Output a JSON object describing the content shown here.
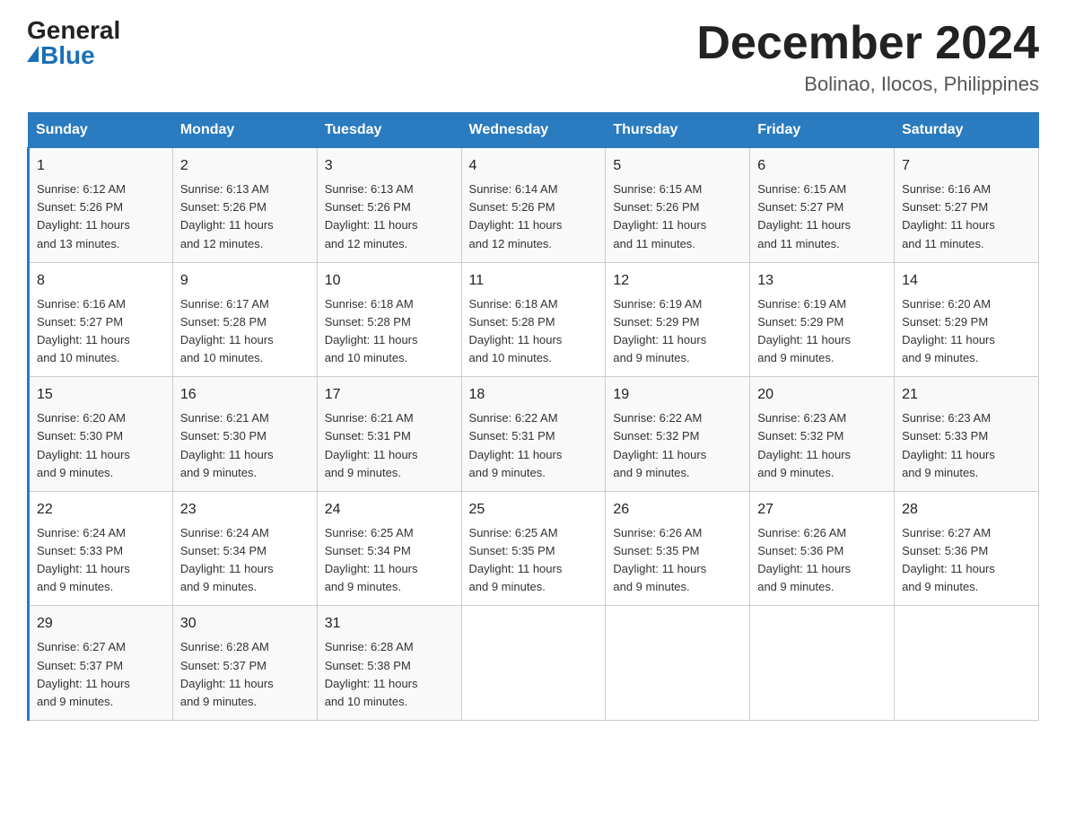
{
  "logo": {
    "general": "General",
    "blue": "Blue"
  },
  "title": {
    "month_year": "December 2024",
    "location": "Bolinao, Ilocos, Philippines"
  },
  "headers": [
    "Sunday",
    "Monday",
    "Tuesday",
    "Wednesday",
    "Thursday",
    "Friday",
    "Saturday"
  ],
  "weeks": [
    [
      {
        "day": "1",
        "sunrise": "6:12 AM",
        "sunset": "5:26 PM",
        "daylight": "11 hours and 13 minutes."
      },
      {
        "day": "2",
        "sunrise": "6:13 AM",
        "sunset": "5:26 PM",
        "daylight": "11 hours and 12 minutes."
      },
      {
        "day": "3",
        "sunrise": "6:13 AM",
        "sunset": "5:26 PM",
        "daylight": "11 hours and 12 minutes."
      },
      {
        "day": "4",
        "sunrise": "6:14 AM",
        "sunset": "5:26 PM",
        "daylight": "11 hours and 12 minutes."
      },
      {
        "day": "5",
        "sunrise": "6:15 AM",
        "sunset": "5:26 PM",
        "daylight": "11 hours and 11 minutes."
      },
      {
        "day": "6",
        "sunrise": "6:15 AM",
        "sunset": "5:27 PM",
        "daylight": "11 hours and 11 minutes."
      },
      {
        "day": "7",
        "sunrise": "6:16 AM",
        "sunset": "5:27 PM",
        "daylight": "11 hours and 11 minutes."
      }
    ],
    [
      {
        "day": "8",
        "sunrise": "6:16 AM",
        "sunset": "5:27 PM",
        "daylight": "11 hours and 10 minutes."
      },
      {
        "day": "9",
        "sunrise": "6:17 AM",
        "sunset": "5:28 PM",
        "daylight": "11 hours and 10 minutes."
      },
      {
        "day": "10",
        "sunrise": "6:18 AM",
        "sunset": "5:28 PM",
        "daylight": "11 hours and 10 minutes."
      },
      {
        "day": "11",
        "sunrise": "6:18 AM",
        "sunset": "5:28 PM",
        "daylight": "11 hours and 10 minutes."
      },
      {
        "day": "12",
        "sunrise": "6:19 AM",
        "sunset": "5:29 PM",
        "daylight": "11 hours and 9 minutes."
      },
      {
        "day": "13",
        "sunrise": "6:19 AM",
        "sunset": "5:29 PM",
        "daylight": "11 hours and 9 minutes."
      },
      {
        "day": "14",
        "sunrise": "6:20 AM",
        "sunset": "5:29 PM",
        "daylight": "11 hours and 9 minutes."
      }
    ],
    [
      {
        "day": "15",
        "sunrise": "6:20 AM",
        "sunset": "5:30 PM",
        "daylight": "11 hours and 9 minutes."
      },
      {
        "day": "16",
        "sunrise": "6:21 AM",
        "sunset": "5:30 PM",
        "daylight": "11 hours and 9 minutes."
      },
      {
        "day": "17",
        "sunrise": "6:21 AM",
        "sunset": "5:31 PM",
        "daylight": "11 hours and 9 minutes."
      },
      {
        "day": "18",
        "sunrise": "6:22 AM",
        "sunset": "5:31 PM",
        "daylight": "11 hours and 9 minutes."
      },
      {
        "day": "19",
        "sunrise": "6:22 AM",
        "sunset": "5:32 PM",
        "daylight": "11 hours and 9 minutes."
      },
      {
        "day": "20",
        "sunrise": "6:23 AM",
        "sunset": "5:32 PM",
        "daylight": "11 hours and 9 minutes."
      },
      {
        "day": "21",
        "sunrise": "6:23 AM",
        "sunset": "5:33 PM",
        "daylight": "11 hours and 9 minutes."
      }
    ],
    [
      {
        "day": "22",
        "sunrise": "6:24 AM",
        "sunset": "5:33 PM",
        "daylight": "11 hours and 9 minutes."
      },
      {
        "day": "23",
        "sunrise": "6:24 AM",
        "sunset": "5:34 PM",
        "daylight": "11 hours and 9 minutes."
      },
      {
        "day": "24",
        "sunrise": "6:25 AM",
        "sunset": "5:34 PM",
        "daylight": "11 hours and 9 minutes."
      },
      {
        "day": "25",
        "sunrise": "6:25 AM",
        "sunset": "5:35 PM",
        "daylight": "11 hours and 9 minutes."
      },
      {
        "day": "26",
        "sunrise": "6:26 AM",
        "sunset": "5:35 PM",
        "daylight": "11 hours and 9 minutes."
      },
      {
        "day": "27",
        "sunrise": "6:26 AM",
        "sunset": "5:36 PM",
        "daylight": "11 hours and 9 minutes."
      },
      {
        "day": "28",
        "sunrise": "6:27 AM",
        "sunset": "5:36 PM",
        "daylight": "11 hours and 9 minutes."
      }
    ],
    [
      {
        "day": "29",
        "sunrise": "6:27 AM",
        "sunset": "5:37 PM",
        "daylight": "11 hours and 9 minutes."
      },
      {
        "day": "30",
        "sunrise": "6:28 AM",
        "sunset": "5:37 PM",
        "daylight": "11 hours and 9 minutes."
      },
      {
        "day": "31",
        "sunrise": "6:28 AM",
        "sunset": "5:38 PM",
        "daylight": "11 hours and 10 minutes."
      },
      null,
      null,
      null,
      null
    ]
  ],
  "labels": {
    "sunrise_prefix": "Sunrise: ",
    "sunset_prefix": "Sunset: ",
    "daylight_prefix": "Daylight: "
  }
}
